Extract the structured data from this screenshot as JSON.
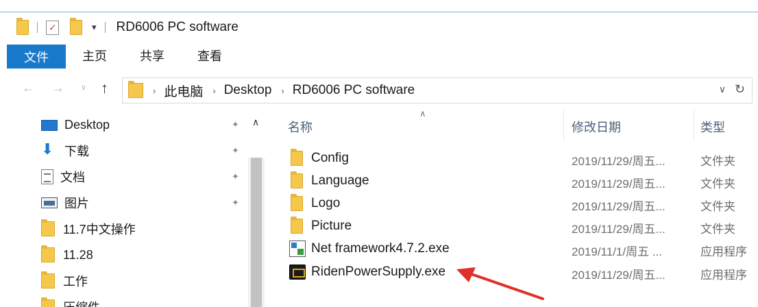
{
  "window": {
    "title": "RD6006 PC software"
  },
  "ribbon": {
    "tabs": [
      "文件",
      "主页",
      "共享",
      "查看"
    ]
  },
  "address": {
    "crumbs": [
      "此电脑",
      "Desktop",
      "RD6006 PC software"
    ]
  },
  "nav_pane": {
    "items": [
      {
        "label": "Desktop",
        "icon": "desktop-icon",
        "pinned": true
      },
      {
        "label": "下载",
        "icon": "download-icon",
        "pinned": true
      },
      {
        "label": "文档",
        "icon": "document-icon",
        "pinned": true
      },
      {
        "label": "图片",
        "icon": "pictures-icon",
        "pinned": true
      },
      {
        "label": "11.7中文操作",
        "icon": "folder-icon",
        "pinned": false
      },
      {
        "label": "11.28",
        "icon": "folder-icon",
        "pinned": false
      },
      {
        "label": "工作",
        "icon": "folder-icon",
        "pinned": false
      },
      {
        "label": "压缩件",
        "icon": "folder-icon",
        "pinned": false
      }
    ]
  },
  "file_list": {
    "columns": {
      "name": "名称",
      "date": "修改日期",
      "type": "类型"
    },
    "rows": [
      {
        "name": "Config",
        "date": "2019/11/29/周五...",
        "type": "文件夹",
        "icon": "folder-icon"
      },
      {
        "name": "Language",
        "date": "2019/11/29/周五...",
        "type": "文件夹",
        "icon": "folder-icon"
      },
      {
        "name": "Logo",
        "date": "2019/11/29/周五...",
        "type": "文件夹",
        "icon": "folder-icon"
      },
      {
        "name": "Picture",
        "date": "2019/11/29/周五...",
        "type": "文件夹",
        "icon": "folder-icon"
      },
      {
        "name": "Net framework4.7.2.exe",
        "date": "2019/11/1/周五 ...",
        "type": "应用程序",
        "icon": "installer-icon"
      },
      {
        "name": "RidenPowerSupply.exe",
        "date": "2019/11/29/周五...",
        "type": "应用程序",
        "icon": "riden-app-icon"
      }
    ]
  },
  "colors": {
    "accent": "#1979ca",
    "annotation": "#e0302a",
    "folder": "#f5c84c"
  }
}
